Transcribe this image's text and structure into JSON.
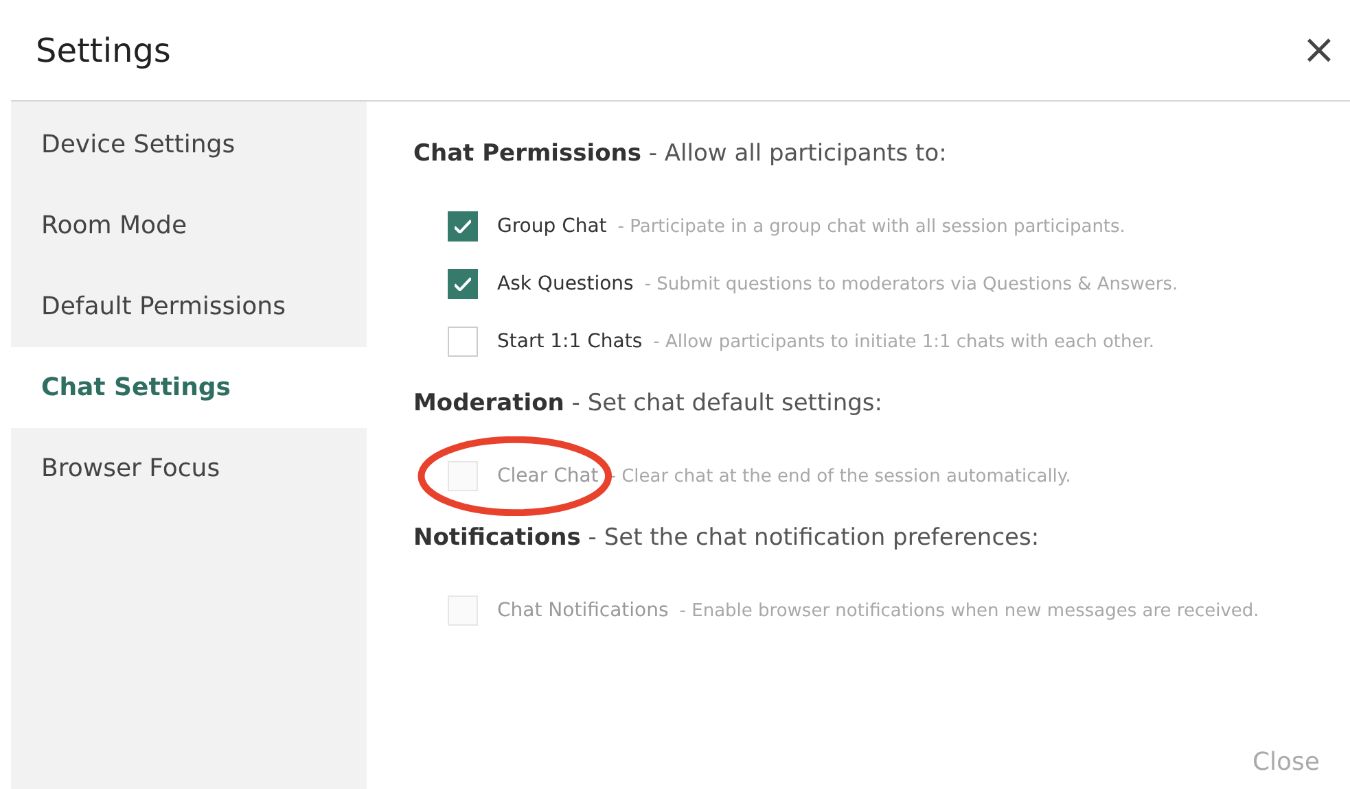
{
  "window": {
    "title": "Settings",
    "close_icon": "×"
  },
  "sidebar": {
    "items": [
      {
        "label": "Device Settings",
        "selected": false
      },
      {
        "label": "Room Mode",
        "selected": false
      },
      {
        "label": "Default Permissions",
        "selected": false
      },
      {
        "label": "Chat Settings",
        "selected": true
      },
      {
        "label": "Browser Focus",
        "selected": false
      }
    ]
  },
  "sections": [
    {
      "title": "Chat Permissions",
      "subtitle": " - Allow all participants to:",
      "options": [
        {
          "label": "Group Chat",
          "description": " - Participate in a group chat with all session participants.",
          "checked": true,
          "disabled": false,
          "highlighted": false
        },
        {
          "label": "Ask Questions",
          "description": " - Submit questions to moderators via Questions & Answers.",
          "checked": true,
          "disabled": false,
          "highlighted": false
        },
        {
          "label": "Start 1:1 Chats",
          "description": " - Allow participants to initiate 1:1 chats with each other.",
          "checked": false,
          "disabled": false,
          "highlighted": false
        }
      ]
    },
    {
      "title": "Moderation",
      "subtitle": " - Set chat default settings:",
      "options": [
        {
          "label": "Clear Chat",
          "description": " - Clear chat at the end of the session automatically.",
          "checked": false,
          "disabled": true,
          "highlighted": true
        }
      ]
    },
    {
      "title": "Notifications",
      "subtitle": " - Set the chat notification preferences:",
      "options": [
        {
          "label": "Chat Notifications",
          "description": " - Enable browser notifications when new messages are received.",
          "checked": false,
          "disabled": true,
          "highlighted": false
        }
      ]
    }
  ],
  "footer": {
    "close_button": "Close"
  }
}
